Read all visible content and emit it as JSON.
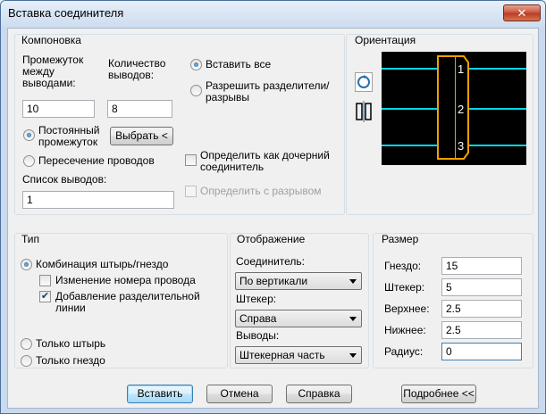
{
  "window": {
    "title": "Вставка соединителя",
    "close_glyph": "✕"
  },
  "layout_group": {
    "title": "Компоновка",
    "spacing_label": "Промежуток между выводами:",
    "count_label": "Количество выводов:",
    "spacing_value": "10",
    "count_value": "8",
    "radio_constant": "Постоянный промежуток",
    "radio_intersect": "Пересечение проводов",
    "choose_button": "Выбрать <",
    "pin_list_label": "Список выводов:",
    "pin_list_value": "1",
    "radio_insert_all": "Вставить все",
    "radio_allow_breaks": "Разрешить разделители/разрывы",
    "check_child": "Определить как дочерний соединитель",
    "check_break": "Определить с разрывом"
  },
  "orientation": {
    "title": "Ориентация",
    "pins": [
      "1",
      "2",
      "3"
    ],
    "colors": {
      "wire": "#00d8e8",
      "body": "#f0a000",
      "pin_text": "#ffffff"
    },
    "icons": [
      "rotate-icon",
      "flip-icon"
    ]
  },
  "type_group": {
    "title": "Тип",
    "radio_combo": "Комбинация штырь/гнездо",
    "check_change_wire": "Изменение номера провода",
    "check_add_divider": "Добавление разделительной линии",
    "radio_pin_only": "Только штырь",
    "radio_socket_only": "Только гнездо"
  },
  "display_group": {
    "title": "Отображение",
    "connector_label": "Соединитель:",
    "connector_value": "По вертикали",
    "plug_label": "Штекер:",
    "plug_value": "Справа",
    "pins_label": "Выводы:",
    "pins_value": "Штекерная часть"
  },
  "size_group": {
    "title": "Размер",
    "fields": [
      {
        "label": "Гнездо:",
        "value": "15"
      },
      {
        "label": "Штекер:",
        "value": "5"
      },
      {
        "label": "Верхнее:",
        "value": "2.5"
      },
      {
        "label": "Нижнее:",
        "value": "2.5"
      },
      {
        "label": "Радиус:",
        "value": "0"
      }
    ]
  },
  "footer": {
    "insert": "Вставить",
    "cancel": "Отмена",
    "help": "Справка",
    "details": "Подробнее <<"
  }
}
